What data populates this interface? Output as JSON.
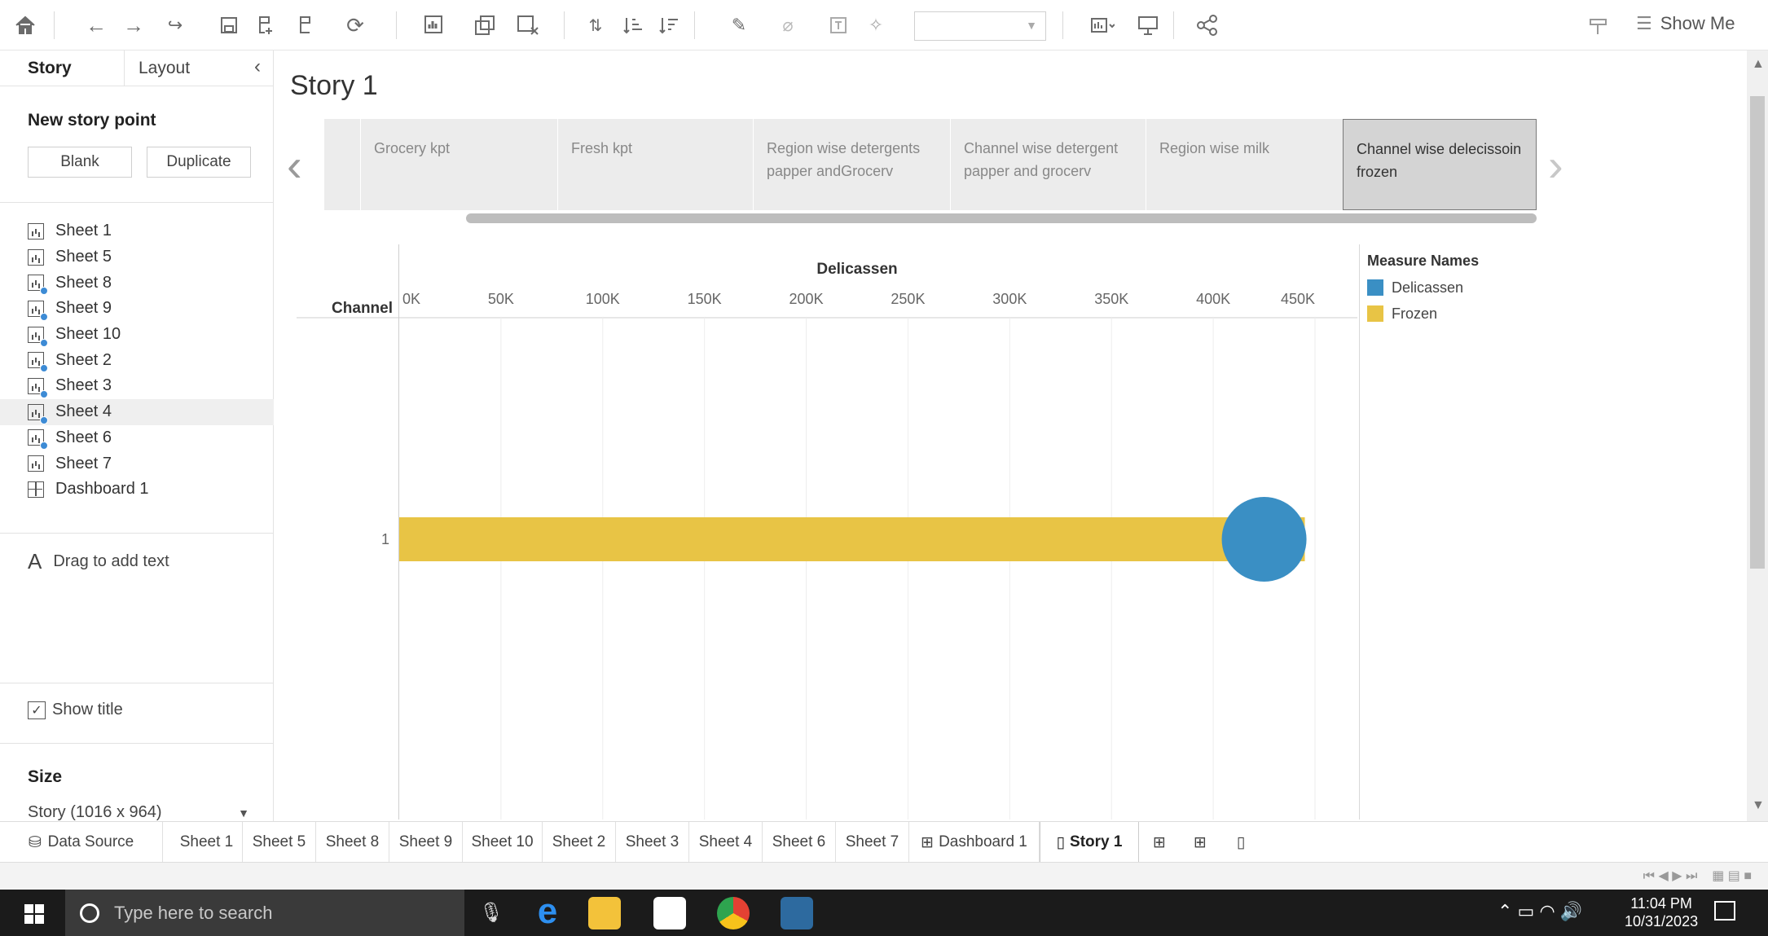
{
  "colors": {
    "delicassen": "#3a8fc4",
    "frozen": "#e8c445",
    "accent": "#3d8bd5"
  },
  "toolbar": {
    "show_me_label": "Show Me"
  },
  "left_panel": {
    "tabs": {
      "story": "Story",
      "layout": "Layout"
    },
    "new_story_point": "New story point",
    "blank_label": "Blank",
    "duplicate_label": "Duplicate",
    "sheets": [
      {
        "label": "Sheet 1",
        "type": "sheet",
        "used": false
      },
      {
        "label": "Sheet 5",
        "type": "sheet",
        "used": false
      },
      {
        "label": "Sheet 8",
        "type": "sheet",
        "used": true
      },
      {
        "label": "Sheet 9",
        "type": "sheet",
        "used": true
      },
      {
        "label": "Sheet 10",
        "type": "sheet",
        "used": true
      },
      {
        "label": "Sheet 2",
        "type": "sheet",
        "used": true
      },
      {
        "label": "Sheet 3",
        "type": "sheet",
        "used": true
      },
      {
        "label": "Sheet 4",
        "type": "sheet",
        "used": true,
        "highlighted": true
      },
      {
        "label": "Sheet 6",
        "type": "sheet",
        "used": true
      },
      {
        "label": "Sheet 7",
        "type": "sheet",
        "used": false
      },
      {
        "label": "Dashboard 1",
        "type": "dashboard",
        "used": false
      }
    ],
    "drag_text": "Drag to add text",
    "show_title_label": "Show title",
    "show_title_checked": true,
    "size_heading": "Size",
    "size_value": "Story (1016 x 964)"
  },
  "story": {
    "title": "Story 1",
    "points": [
      {
        "label": "Grocery kpt",
        "active": false
      },
      {
        "label": "Fresh kpt",
        "active": false
      },
      {
        "label": "Region wise detergents papper andGrocerv",
        "active": false
      },
      {
        "label": "Channel wise detergent papper and grocerv",
        "active": false
      },
      {
        "label": "Region wise milk",
        "active": false
      },
      {
        "label": "Channel wise delecissoin frozen",
        "active": true
      }
    ]
  },
  "chart_data": {
    "type": "bar",
    "title": "",
    "xlabel": "Delicassen",
    "ylabel": "Channel",
    "categories": [
      "1"
    ],
    "xlim": [
      0,
      450000
    ],
    "xticks": [
      "0K",
      "50K",
      "100K",
      "150K",
      "200K",
      "250K",
      "300K",
      "350K",
      "400K",
      "450K"
    ],
    "xtick_values": [
      0,
      50000,
      100000,
      150000,
      200000,
      250000,
      300000,
      350000,
      400000,
      450000
    ],
    "series": [
      {
        "name": "Frozen",
        "mark": "bar",
        "values": [
          445000
        ]
      },
      {
        "name": "Delicassen",
        "mark": "circle",
        "values": [
          425000
        ]
      }
    ],
    "legend": {
      "title": "Measure Names",
      "placement": "right",
      "items": [
        "Delicassen",
        "Frozen"
      ]
    },
    "grid": true
  },
  "sheet_tabs": {
    "data_source": "Data Source",
    "tabs": [
      "Sheet 1",
      "Sheet 5",
      "Sheet 8",
      "Sheet 9",
      "Sheet 10",
      "Sheet 2",
      "Sheet 3",
      "Sheet 4",
      "Sheet 6",
      "Sheet 7",
      "Dashboard 1",
      "Story 1"
    ],
    "active": "Story 1"
  },
  "taskbar": {
    "search_placeholder": "Type here to search",
    "time": "11:04 PM",
    "date": "10/31/2023"
  }
}
